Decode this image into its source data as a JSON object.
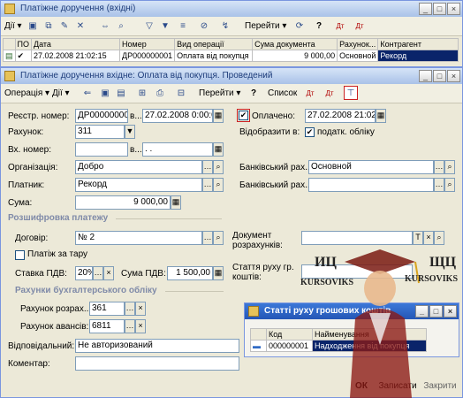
{
  "list_window": {
    "title": "Платіжне доручення (вхідні)",
    "actions_label": "Дії",
    "goto_label": "Перейти",
    "columns": [
      "ПО",
      "Дата",
      "Номер",
      "Вид операції",
      "Сума документа",
      "Рахунок...",
      "Контрагент"
    ],
    "row": {
      "date": "27.02.2008 21:02:15",
      "number": "ДР000000001",
      "op_type": "Оплата від покупця",
      "amount": "9 000,00",
      "account": "Основной",
      "counterparty": "Рекорд"
    }
  },
  "doc_window": {
    "title": "Платіжне доручення вхідне: Оплата від покупця. Проведений",
    "toolbar": {
      "operation_label": "Операція",
      "actions_label": "Дії",
      "goto_label": "Перейти",
      "list_label": "Список"
    },
    "reg_number_label": "Реєстр. номер:",
    "reg_number": "ДР00000000",
    "reg_date_prefix": "в...",
    "reg_date": "27.02.2008 0:00:0",
    "paid_label": "Оплачено:",
    "paid_date": "27.02.2008 21:02",
    "account_label": "Рахунок:",
    "account": "311",
    "reflect_label": "Відобразити в:",
    "tax_accounting_label": "податк. обліку",
    "in_number_label": "Вх. номер:",
    "in_date_prefix": "в...",
    "in_date": ". .",
    "org_label": "Організація:",
    "org": "Добро",
    "bank_account_label": "Банківський рах...",
    "bank_account": "Основной",
    "payer_label": "Платник:",
    "payer": "Рекорд",
    "bank_account2_label": "Банківський рах...",
    "bank_account2": "",
    "sum_label": "Сума:",
    "sum": "9 000,00",
    "decoding_section": "Розшифровка платежу",
    "contract_label": "Договір:",
    "contract": "№ 2",
    "settlement_doc_label": "Документ розрахунків:",
    "settlement_doc": "",
    "prepay_label": "Платіж за тару",
    "vat_rate_label": "Ставка ПДВ:",
    "vat_rate": "20%",
    "vat_sum_label": "Сума ПДВ:",
    "vat_sum": "1 500,00",
    "cashflow_label": "Стаття руху гр. коштів:",
    "accounts_section": "Рахунки бухгалтерського обліку",
    "settle_account_label": "Рахунок розрах...",
    "settle_account": "361",
    "advance_account_label": "Рахунок авансів:",
    "advance_account": "6811",
    "responsible_label": "Відповідальний:",
    "responsible": "Не авторизований",
    "comment_label": "Коментар:",
    "comment": "",
    "ok_label": "ОК",
    "save_label": "Записати",
    "close_label": "Закрити"
  },
  "popup": {
    "title": "Статті руху грошових коштів",
    "col_code": "Код",
    "col_name": "Найменування",
    "row": {
      "code": "000000001",
      "name": "Надходження від покупця"
    }
  },
  "watermark": {
    "left": "ИЦ",
    "left_sub": "KURSOVIKS",
    "right": "ЩЦ",
    "right_sub": "KURSOVIKS"
  },
  "colors": {
    "accent": "#316ac5",
    "title_text": "#1d3c7a",
    "selection": "#0a246a"
  }
}
